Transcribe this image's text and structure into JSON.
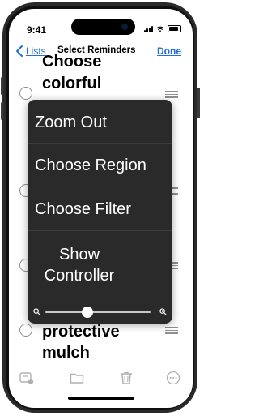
{
  "status_bar": {
    "time": "9:41"
  },
  "nav": {
    "back_label": "Lists",
    "title": "Select Reminders",
    "done_label": "Done"
  },
  "reminders": [
    {
      "line1": "Choose",
      "line2": "colorful"
    },
    {
      "line1": "protective",
      "line2": "mulch"
    }
  ],
  "context_menu": {
    "items": [
      {
        "label": "Zoom Out"
      },
      {
        "label": "Choose Region"
      },
      {
        "label": "Choose Filter"
      },
      {
        "label": "Show Controller"
      }
    ],
    "zoom_level": 0.4
  },
  "toolbar": {
    "icons": [
      "new-list-icon",
      "folder-icon",
      "trash-icon",
      "more-icon"
    ]
  }
}
